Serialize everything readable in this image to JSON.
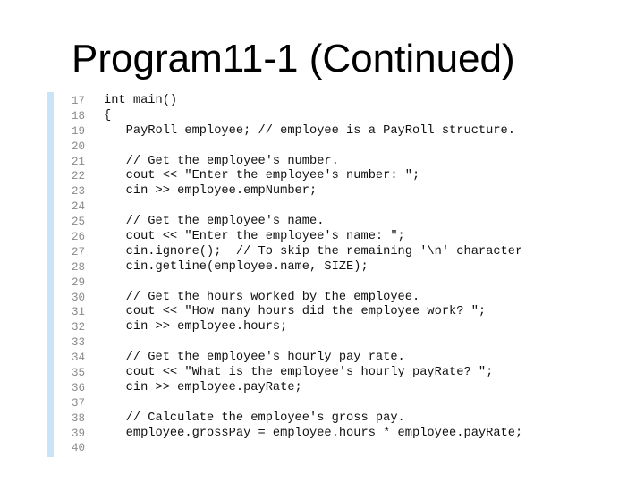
{
  "title": "Program11-1 (Continued)",
  "code": {
    "accent_bar_color": "#c9e4f6",
    "lines": [
      {
        "num": "17",
        "text": "int main()"
      },
      {
        "num": "18",
        "text": "{"
      },
      {
        "num": "19",
        "text": "   PayRoll employee; // employee is a PayRoll structure."
      },
      {
        "num": "20",
        "text": ""
      },
      {
        "num": "21",
        "text": "   // Get the employee's number."
      },
      {
        "num": "22",
        "text": "   cout << \"Enter the employee's number: \";"
      },
      {
        "num": "23",
        "text": "   cin >> employee.empNumber;"
      },
      {
        "num": "24",
        "text": ""
      },
      {
        "num": "25",
        "text": "   // Get the employee's name."
      },
      {
        "num": "26",
        "text": "   cout << \"Enter the employee's name: \";"
      },
      {
        "num": "27",
        "text": "   cin.ignore();  // To skip the remaining '\\n' character"
      },
      {
        "num": "28",
        "text": "   cin.getline(employee.name, SIZE);"
      },
      {
        "num": "29",
        "text": ""
      },
      {
        "num": "30",
        "text": "   // Get the hours worked by the employee."
      },
      {
        "num": "31",
        "text": "   cout << \"How many hours did the employee work? \";"
      },
      {
        "num": "32",
        "text": "   cin >> employee.hours;"
      },
      {
        "num": "33",
        "text": ""
      },
      {
        "num": "34",
        "text": "   // Get the employee's hourly pay rate."
      },
      {
        "num": "35",
        "text": "   cout << \"What is the employee's hourly payRate? \";"
      },
      {
        "num": "36",
        "text": "   cin >> employee.payRate;"
      },
      {
        "num": "37",
        "text": ""
      },
      {
        "num": "38",
        "text": "   // Calculate the employee's gross pay."
      },
      {
        "num": "39",
        "text": "   employee.grossPay = employee.hours * employee.payRate;"
      },
      {
        "num": "40",
        "text": ""
      }
    ]
  }
}
